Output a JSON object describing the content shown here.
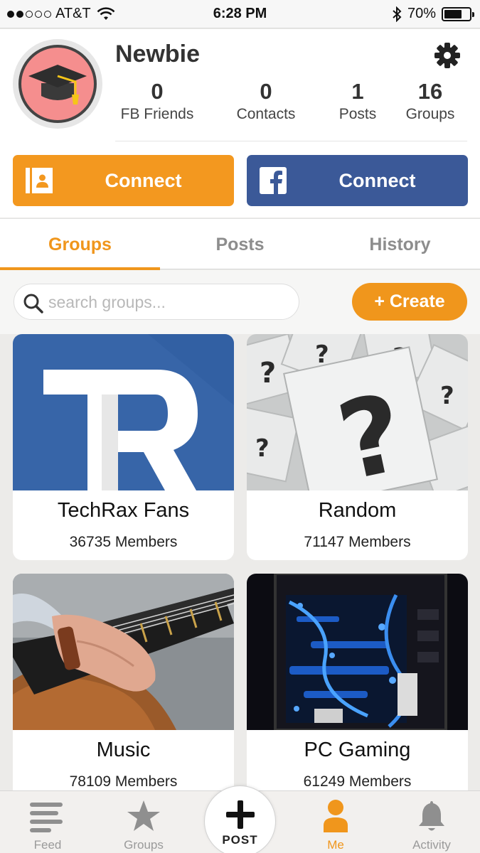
{
  "status_bar": {
    "carrier": "AT&T",
    "time": "6:28 PM",
    "battery_percent": "70%",
    "battery_level": 0.7,
    "signal_bars_filled": 2,
    "signal_bars_total": 5
  },
  "profile": {
    "username": "Newbie",
    "avatar_icon": "graduation-cap-icon",
    "stats": [
      {
        "value": "0",
        "label": "FB Friends"
      },
      {
        "value": "0",
        "label": "Contacts"
      },
      {
        "value": "1",
        "label": "Posts"
      },
      {
        "value": "16",
        "label": "Groups"
      }
    ],
    "connect_contacts_label": "Connect",
    "connect_facebook_label": "Connect"
  },
  "tabs": [
    {
      "label": "Groups",
      "active": true
    },
    {
      "label": "Posts",
      "active": false
    },
    {
      "label": "History",
      "active": false
    }
  ],
  "search": {
    "placeholder": "search groups...",
    "value": ""
  },
  "create_label": "+ Create",
  "groups": [
    {
      "name": "TechRax Fans",
      "members": "36735 Members",
      "image": "techrax-logo"
    },
    {
      "name": "Random",
      "members": "71147 Members",
      "image": "question-mark-cards"
    },
    {
      "name": "Music",
      "members": "78109 Members",
      "image": "guitar-photo"
    },
    {
      "name": "PC Gaming",
      "members": "61249 Members",
      "image": "gaming-pc-photo"
    }
  ],
  "tab_bar": [
    {
      "label": "Feed",
      "icon": "feed-icon",
      "active": false
    },
    {
      "label": "Groups",
      "icon": "star-icon",
      "active": false
    },
    {
      "label": "POST",
      "icon": "plus-icon",
      "active": false
    },
    {
      "label": "Me",
      "icon": "person-icon",
      "active": true
    },
    {
      "label": "Activity",
      "icon": "bell-icon",
      "active": false
    }
  ],
  "colors": {
    "accent": "#f0961c",
    "facebook": "#3b5998",
    "contacts_button": "#f3981f",
    "avatar_background": "#f58e8e"
  }
}
